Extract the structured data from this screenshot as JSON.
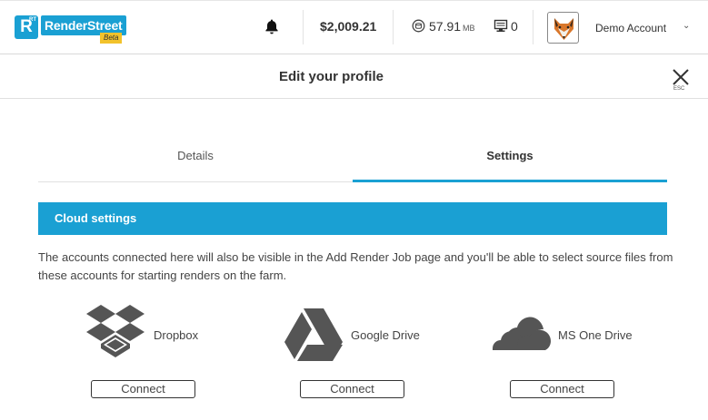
{
  "header": {
    "logo_mark": "R",
    "logo_mark_sup": "RT",
    "logo_text": "RenderStreet",
    "logo_beta": "Beta",
    "balance": "$2,009.21",
    "storage_value": "57.91",
    "storage_unit": "MB",
    "machines_count": "0",
    "account_name": "Demo Account",
    "account_chevron": "⌄"
  },
  "modal": {
    "title": "Edit your profile",
    "esc_label": "ESC"
  },
  "tabs": [
    {
      "label": "Details",
      "active": false
    },
    {
      "label": "Settings",
      "active": true
    }
  ],
  "cloud": {
    "section_title": "Cloud settings",
    "description": "The accounts connected here will also be visible in the Add Render Job page and you'll be able to select source files from these accounts for starting renders on the farm.",
    "providers": [
      {
        "name": "Dropbox",
        "icon": "dropbox-icon",
        "button": "Connect"
      },
      {
        "name": "Google Drive",
        "icon": "google-drive-icon",
        "button": "Connect"
      },
      {
        "name": "MS One Drive",
        "icon": "onedrive-icon",
        "button": "Connect"
      }
    ]
  },
  "colors": {
    "accent": "#1aa0d3",
    "beta_badge": "#f2c22b",
    "icon_gray": "#555555"
  }
}
